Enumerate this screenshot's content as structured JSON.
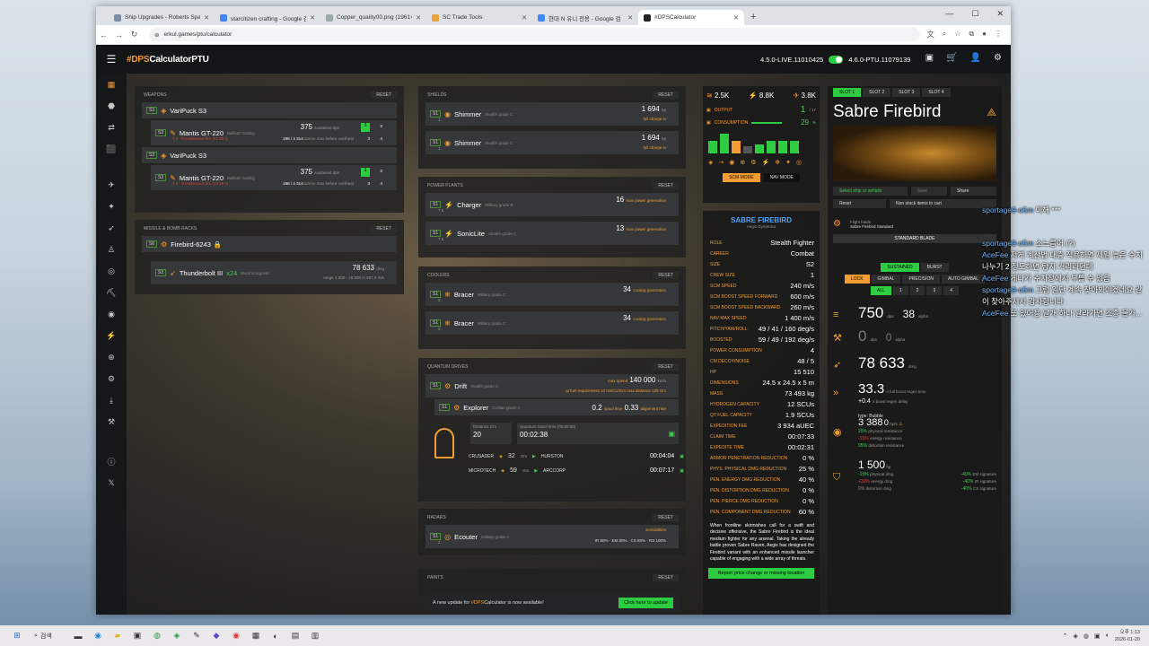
{
  "browser": {
    "tabs": [
      {
        "title": "Ship Upgrades - Roberts Spac"
      },
      {
        "title": "starcitizen crafting - Google 검"
      },
      {
        "title": "Copper_quality00.png (1961×"
      },
      {
        "title": "SC Trade Tools"
      },
      {
        "title": "현대 N 유니 전용 - Google 검"
      },
      {
        "title": "#DPSCalculator"
      }
    ],
    "url": "erkul.games/ptu/calculator"
  },
  "app": {
    "logo_hash": "#DPS",
    "logo_text": "CalculatorPTU",
    "version_live": "4.5.0-LIVE.11010425",
    "version_ptu": "4.6.0-PTU.11079139",
    "cart_badge": "0",
    "bell_badge": "0"
  },
  "weapons": {
    "header": "Weapons",
    "reset": "RESET",
    "groups": [
      {
        "size": "S3",
        "name": "VariPuck S3",
        "sub_size": "S3",
        "sub_name": "Mantis GT-220",
        "sub_type": "Ballistic Gatling",
        "dps": "375",
        "dps_label": "sustained dps",
        "line": "7.3 · 5 continuous fire (22.28 s)",
        "ammo": "196 / 4 314",
        "ammo_label": "ammo max before overheat",
        "b1": "1",
        "b2": "2",
        "b3": "3",
        "b4": "4"
      },
      {
        "size": "S3",
        "name": "VariPuck S3",
        "sub_size": "S3",
        "sub_name": "Mantis GT-220",
        "sub_type": "Ballistic Gatling",
        "dps": "375",
        "dps_label": "sustained dps",
        "line": "7.3 · 5 continuous fire (22.28 s)",
        "ammo": "196 / 4 314",
        "ammo_label": "ammo max before overheat",
        "b1": "1",
        "b2": "2",
        "b3": "3",
        "b4": "4"
      }
    ]
  },
  "missiles": {
    "header": "Missile & bomb racks",
    "reset": "RESET",
    "rack_size": "S6",
    "rack": "Firebird-6243",
    "missile_size": "S3",
    "missile": "Thunderbolt III",
    "count": "x24",
    "type": "Electromagnetic",
    "dmg": "78 633",
    "dmg_label": "dmg",
    "range": "range 1 900 - 25 000 m",
    "speed": "857.5 m/s"
  },
  "shields": {
    "header": "Shields",
    "reset": "RESET",
    "items": [
      {
        "size": "S1",
        "name": "Shimmer",
        "grade": "Stealth grade C",
        "val": "1 694",
        "unit": "hp",
        "sub": "full charge in",
        "l1": "1",
        "l2": "1"
      },
      {
        "size": "S1",
        "name": "Shimmer",
        "grade": "Stealth grade C",
        "val": "1 694",
        "unit": "hp",
        "sub": "full charge in",
        "l1": "1",
        "l2": "1"
      }
    ]
  },
  "power": {
    "header": "Power plants",
    "reset": "RESET",
    "items": [
      {
        "size": "S1",
        "name": "Charger",
        "grade": "Military grade B",
        "val": "16",
        "label": "max power generation",
        "l": "7.6"
      },
      {
        "size": "S1",
        "name": "SonicLite",
        "grade": "Stealth grade C",
        "val": "13",
        "label": "max power generation",
        "l": "7.6"
      }
    ]
  },
  "coolers": {
    "header": "Coolers",
    "reset": "RESET",
    "items": [
      {
        "size": "S1",
        "name": "Bracer",
        "grade": "Military grade C",
        "val": "34",
        "label": "cooling generation",
        "l": "3"
      },
      {
        "size": "S1",
        "name": "Bracer",
        "grade": "Military grade C",
        "val": "34",
        "label": "cooling generation",
        "l": "3"
      }
    ]
  },
  "quantum": {
    "header": "Quantum drives",
    "reset": "RESET",
    "size": "S1",
    "name": "Drift",
    "grade": "Stealth grade C",
    "speed_label": "max speed",
    "speed": "140 000",
    "speed_unit": "km/s",
    "fuel_req": "qt fuel requirement 10 mSCU/Gm",
    "max_dist": "max distance 130 Gm",
    "alt_size": "S1",
    "alt_name": "Explorer",
    "alt_grade": "Civilian grade A",
    "spool": "0.2",
    "spool_label": "spool time",
    "align": "0.33",
    "align_label": "alignment rate",
    "dist_label": "Distance Gm",
    "dist": "20",
    "time_label": "Quantum travel time (00:00:00)",
    "time": "00:02:38",
    "routes": [
      {
        "from": "CRUSADER",
        "dist": "32",
        "unit": "Gm",
        "to": "HURSTON",
        "time": "00:04:04"
      },
      {
        "from": "MICROTECH",
        "dist": "59",
        "unit": "Gm",
        "to": "ARCCORP",
        "time": "00:07:17"
      }
    ]
  },
  "radars": {
    "header": "Radars",
    "reset": "RESET",
    "size": "S1",
    "name": "Ecouter",
    "grade": "Military grade A",
    "l": "2",
    "l2": "2",
    "sens": "sensibilities",
    "ir": "IR 80%",
    "em": "EM 80%",
    "cs": "CS 80%",
    "rs": "RS 100%"
  },
  "paints": {
    "header": "Paints",
    "reset": "RESET"
  },
  "update_bar": {
    "text_before": "A new update for ",
    "text_hash": "#DPS",
    "text_after": "Calculator is now available!",
    "button": "Click here to update"
  },
  "resources": {
    "heat": "2.5K",
    "power": "8.8K",
    "cooling": "3.8K",
    "output_label": "OUTPUT",
    "output": "1",
    "output_total": "/ 17",
    "consumption_label": "CONSUMPTION",
    "consumption": "29",
    "consumption_unit": "%",
    "scm_mode": "SCM MODE",
    "nav_mode": "NAV MODE"
  },
  "ship_info": {
    "name": "SABRE FIREBIRD",
    "maker": "Aegis Dynamics",
    "stats": [
      {
        "k": "Role",
        "v": "Stealth Fighter"
      },
      {
        "k": "Career",
        "v": "Combat"
      },
      {
        "k": "Size",
        "v": "S2"
      },
      {
        "k": "Crew size",
        "v": "1"
      },
      {
        "k": "SCM speed",
        "v": "240 m/s"
      },
      {
        "k": "SCM boost speed forward",
        "v": "600 m/s"
      },
      {
        "k": "SCM boost speed backward",
        "v": "260 m/s"
      },
      {
        "k": "NAV max speed",
        "v": "1 400 m/s"
      },
      {
        "k": "Pitch/Yaw/Roll",
        "v": "49 / 41 / 160 deg/s"
      },
      {
        "k": "Boosted",
        "v": "59 / 49 / 192 deg/s"
      },
      {
        "k": "Power consumption",
        "v": "4"
      },
      {
        "k": "CM decoy/noise",
        "v": "48 / 5"
      },
      {
        "k": "HP",
        "v": "15 510"
      },
      {
        "k": "Dimensions",
        "v": "24.5 x 24.5 x 5 m"
      },
      {
        "k": "Mass",
        "v": "73 493 kg"
      },
      {
        "k": "Hydrogen capacity",
        "v": "12 SCUs"
      },
      {
        "k": "QT fuel capacity",
        "v": "1.9 SCUs"
      },
      {
        "k": "Expedition fee",
        "v": "3 934 aUEC"
      },
      {
        "k": "Claim time",
        "v": "00:07:33"
      },
      {
        "k": "Expedite time",
        "v": "00:02:31"
      },
      {
        "k": "Armor penetration reduction",
        "v": "0 %"
      },
      {
        "k": "Phys. physical dmg reduction",
        "v": "25 %"
      },
      {
        "k": "Pen. energy dmg reduction",
        "v": "40 %"
      },
      {
        "k": "Pen. distortion dmg reduction",
        "v": "0 %"
      },
      {
        "k": "Pen. pierce dmg reduction",
        "v": "0 %"
      },
      {
        "k": "Pen. component dmg reduction",
        "v": "60 %"
      }
    ],
    "description": "When frontline skirmishes call for a swift and decisive offensive, the Sabre Firebird is the ideal medium fighter for any arsenal. Taking the already battle proven Sabre Raven, Aegis has designed the Firebird variant with an enhanced missile launcher capable of engaging with a wide array of threats.",
    "report_button": "Report price change or missing location"
  },
  "right": {
    "slots": [
      "SLOT 1",
      "SLOT 2",
      "SLOT 3",
      "SLOT 4"
    ],
    "ship_title": "Sabre Firebird",
    "select_btn": "Select ship or vehicle",
    "save_btn": "Save",
    "share_btn": "Share",
    "reset_btn": "Reset",
    "stock_btn": "Non stock items to cart",
    "flight_label": "Flight blade",
    "flight_value": "Sabre Firebird Standard",
    "blade": "STANDARD BLADE",
    "modes": [
      "SUSTAINED",
      "BURST"
    ],
    "gimbals": [
      "LOCK",
      "GIMBAL",
      "PRECISION",
      "AUTO GIMBAL"
    ],
    "filters": [
      "ALL",
      "1",
      "2",
      "3",
      "4"
    ],
    "dps_main": "750",
    "dps_unit": "dps",
    "dps_alpha": "38",
    "alpha_unit": "alpha",
    "dps2": "0",
    "dps2_alpha": "0",
    "missile_dmg": "78 633",
    "missile_unit": "dmg",
    "boost": "33.3",
    "boost_label": "s full boost regen time",
    "boost_sub": "+0.4",
    "boost_sub_label": "s boost regen delay",
    "shield_type": "type: Bubble",
    "shield_hp": "3 388",
    "shield_regen": "0",
    "shield_regen_unit": "hp/s",
    "res1": "25%",
    "res1_label": "physical resistance",
    "res2": "-15%",
    "res2_label": "energy resistance",
    "res3": "95%",
    "res3_label": "distortion resistance",
    "armor_hp": "1 500",
    "armor_unit": "hp",
    "a1": "-15%",
    "a1_label": "physical dmg",
    "a2": "+30%",
    "a2_label": "energy dmg",
    "a3": "0%",
    "a3_label": "distortion dmg",
    "s1": "-40%",
    "s1_label": "EM signature",
    "s2": "-40%",
    "s2_label": "IR signature",
    "s3": "-40%",
    "s3_label": "CS signature"
  },
  "chat": [
    {
      "user": "sportage9-o5m",
      "msg": "이해 ***"
    },
    {
      "user": "sportage9-o5m",
      "msg": "소느릅어 (?)"
    },
    {
      "user": "AceFee",
      "msg": "저게 계산법 대충 적용하면 제일 높은 수치 나누기 2 정도하면 탐지 거리라던데"
    },
    {
      "user": "AceFee",
      "msg": "게다가 주차장에서 부를 수 있음"
    },
    {
      "user": "sportage9-o5m",
      "msg": "그럼 일단 계속 찾아봐야겠네요 같이 찾아주셔서 감사합니다"
    },
    {
      "user": "AceFee",
      "msg": "또 있어용 날개 하나 날라가면 조종 불가..."
    }
  ],
  "taskbar": {
    "search": "검색",
    "time": "오후 1:13",
    "date": "2026-01-20"
  }
}
